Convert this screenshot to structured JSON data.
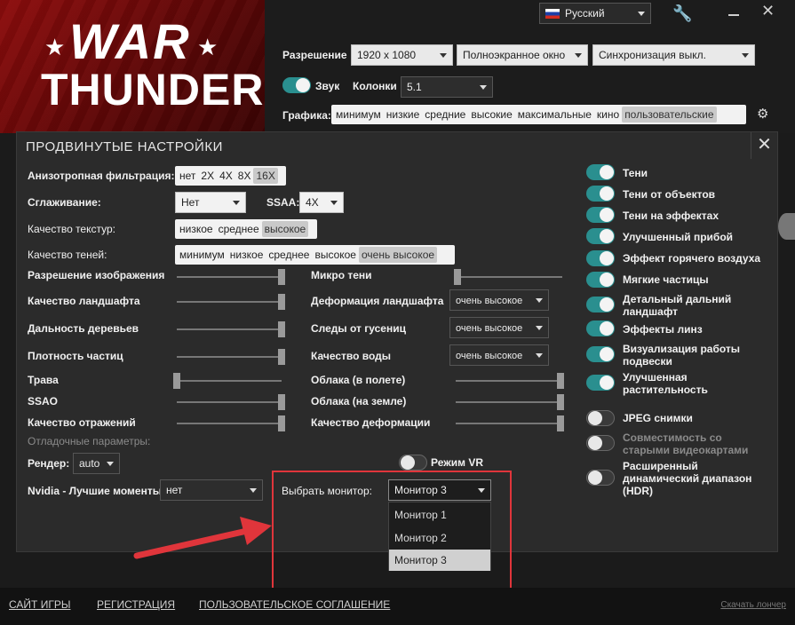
{
  "header": {
    "logo_top": "WAR",
    "logo_bottom": "THUNDER",
    "language": "Русский",
    "resolution_label": "Разрешение",
    "resolution_value": "1920 x 1080",
    "window_mode": "Полноэкранное окно",
    "vsync": "Синхронизация выкл.",
    "sound_label": "Звук",
    "speakers_label": "Колонки",
    "speakers_value": "5.1",
    "graphics_label": "Графика:",
    "graphics_presets": [
      "минимум",
      "низкие",
      "средние",
      "высокие",
      "максимальные",
      "кино",
      "пользовательские"
    ],
    "graphics_selected": "пользовательские"
  },
  "panel": {
    "title": "ПРОДВИНУТЫЕ НАСТРОЙКИ",
    "close": "✕",
    "aniso_label": "Анизотропная фильтрация:",
    "aniso_options": [
      "нет",
      "2X",
      "4X",
      "8X",
      "16X"
    ],
    "aa_label": "Сглаживание:",
    "aa_value": "Нет",
    "ssaa_label": "SSAA:",
    "ssaa_value": "4X",
    "texture_label": "Качество текстур:",
    "texture_options": [
      "низкое",
      "среднее",
      "высокое"
    ],
    "shadow_label": "Качество теней:",
    "shadow_options": [
      "минимум",
      "низкое",
      "среднее",
      "высокое",
      "очень высокое"
    ],
    "sliders_left": [
      {
        "label": "Разрешение изображения",
        "value": 1.0
      },
      {
        "label": "Качество ландшафта",
        "value": 1.0
      },
      {
        "label": "Дальность деревьев",
        "value": 1.0
      },
      {
        "label": "Плотность частиц",
        "value": 1.0
      },
      {
        "label": "Трава",
        "value": 0.0
      },
      {
        "label": "SSAO",
        "value": 1.0
      },
      {
        "label": "Качество отражений",
        "value": 1.0
      }
    ],
    "micro_shadows_label": "Микро тени",
    "terrain_deform_label": "Деформация ландшафта",
    "terrain_deform_value": "очень высокое",
    "tracks_label": "Следы от гусениц",
    "tracks_value": "очень высокое",
    "water_label": "Качество воды",
    "water_value": "очень высокое",
    "sliders_mid": [
      {
        "label": "Облака (в полете)",
        "value": 1.0
      },
      {
        "label": "Облака (на земле)",
        "value": 1.0
      },
      {
        "label": "Качество деформации",
        "value": 1.0
      }
    ],
    "debug_label": "Отладочные параметры:",
    "renderer_label": "Рендер:",
    "renderer_value": "auto",
    "vr_label": "Режим VR",
    "nvidia_label": "Nvidia - Лучшие моменты:",
    "nvidia_value": "нет",
    "monitor_label": "Выбрать монитор:",
    "monitor_value": "Монитор 3",
    "monitor_options": [
      "Монитор 1",
      "Монитор 2",
      "Монитор 3"
    ],
    "toggles_right": [
      {
        "label": "Тени",
        "on": true
      },
      {
        "label": "Тени от объектов",
        "on": true
      },
      {
        "label": "Тени на эффектах",
        "on": true
      },
      {
        "label": "Улучшенный прибой",
        "on": true
      },
      {
        "label": "Эффект горячего воздуха",
        "on": true
      },
      {
        "label": "Мягкие частицы",
        "on": true
      },
      {
        "label": "Детальный дальний ландшафт",
        "on": true
      },
      {
        "label": "Эффекты линз",
        "on": true
      },
      {
        "label": "Визуализация работы подвески",
        "on": true
      },
      {
        "label": "Улучшенная растительность",
        "on": true
      },
      {
        "label": "JPEG снимки",
        "on": false
      },
      {
        "label": "Совместимость со старыми видеокартами",
        "on": false
      },
      {
        "label": "Расширенный динамический диапазон (HDR)",
        "on": false
      }
    ]
  },
  "footer": {
    "links": [
      "САЙТ ИГРЫ",
      "РЕГИСТРАЦИЯ",
      "ПОЛЬЗОВАТЕЛЬСКОЕ СОГЛАШЕНИЕ"
    ],
    "download": "Скачать лончер"
  },
  "colors": {
    "accent": "#2a8f8f",
    "annotation": "#e0353b",
    "banner": "#8e0d0d"
  }
}
